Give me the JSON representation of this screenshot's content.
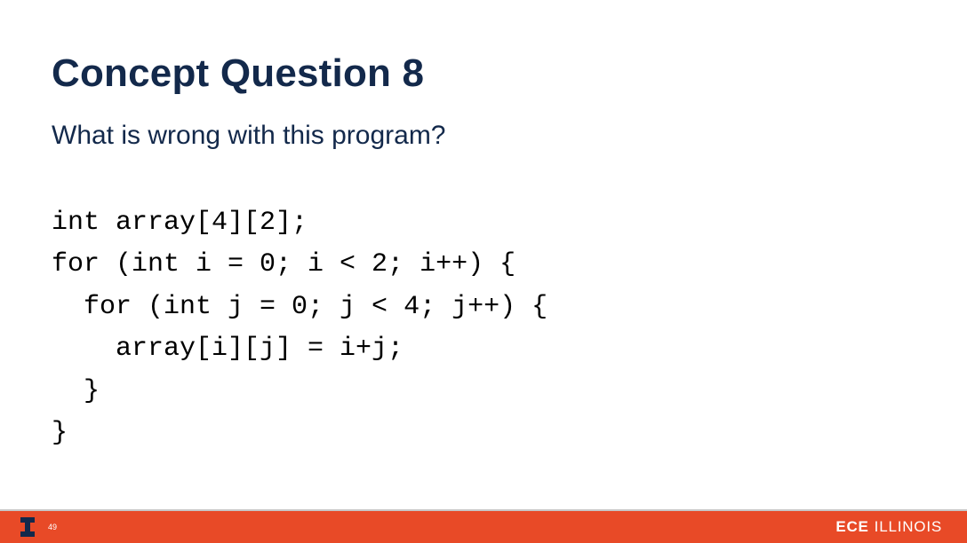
{
  "title": "Concept Question 8",
  "question": "What is wrong with this program?",
  "code": "int array[4][2];\nfor (int i = 0; i < 2; i++) {\n  for (int j = 0; j < 4; j++) {\n    array[i][j] = i+j;\n  }\n}",
  "footer": {
    "page_number": "49",
    "dept": "ECE",
    "school": "ILLINOIS"
  },
  "colors": {
    "brand_navy": "#13294b",
    "brand_orange": "#e84a27"
  }
}
